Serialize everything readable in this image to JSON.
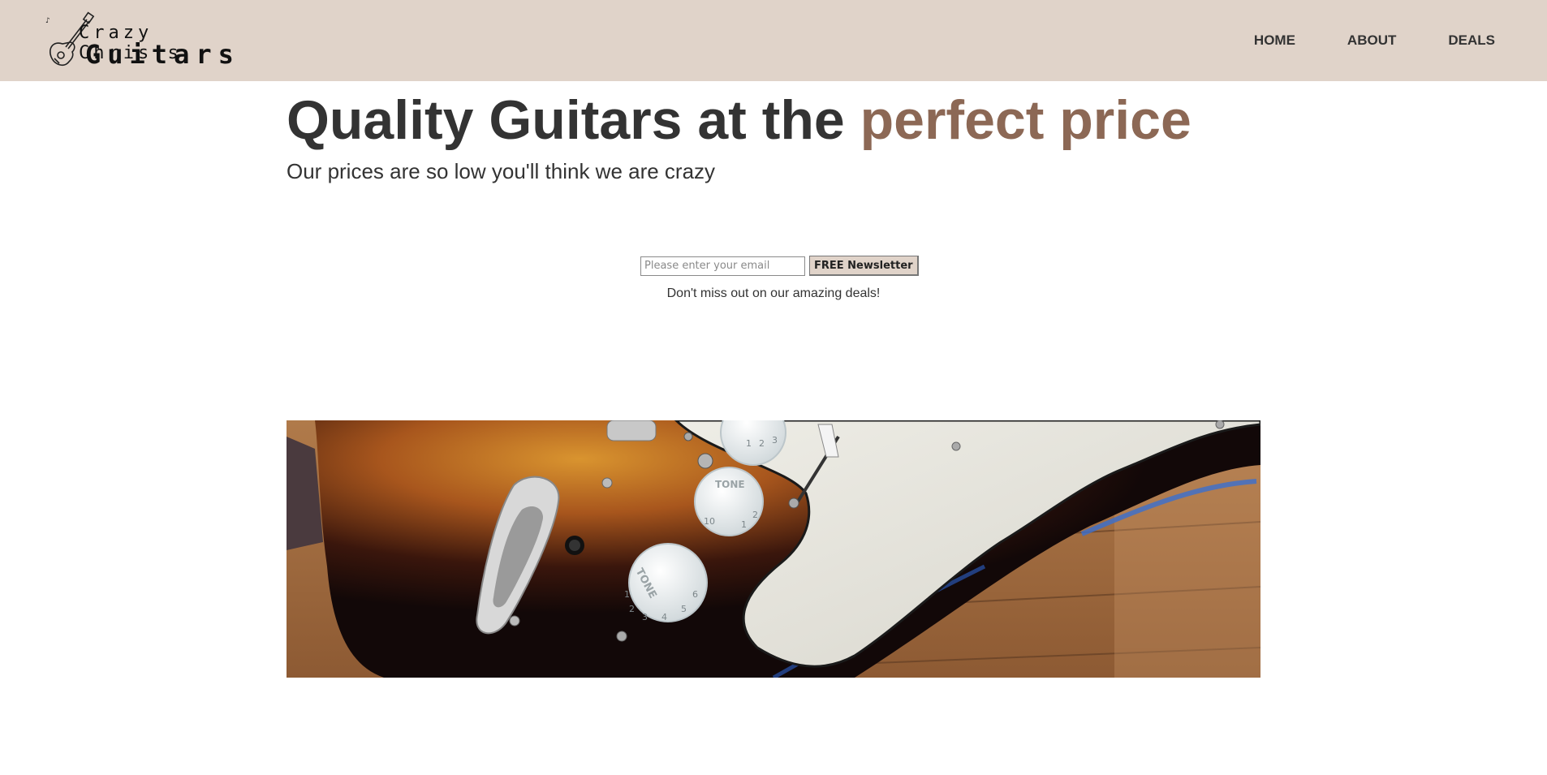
{
  "header": {
    "logo": {
      "line1": "Crazy Chris's",
      "line2": "Guitars"
    },
    "nav": [
      {
        "label": "HOME"
      },
      {
        "label": "ABOUT"
      },
      {
        "label": "DEALS"
      }
    ]
  },
  "hero": {
    "title_main": "Quality Guitars at the ",
    "title_accent": "perfect price",
    "subtitle": "Our prices are so low you'll think we are crazy"
  },
  "newsletter": {
    "email_placeholder": "Please enter your email",
    "button_label": "FREE Newsletter",
    "note": "Don't miss out on our amazing deals!"
  },
  "image": {
    "knob_label_1": "TONE",
    "knob_label_2": "TONE",
    "knob_numbers_top": [
      "1",
      "2",
      "3"
    ],
    "knob_numbers_mid": [
      "10",
      "1",
      "2"
    ],
    "knob_numbers_bottom": [
      "1",
      "2",
      "3",
      "4",
      "5",
      "6"
    ]
  },
  "colors": {
    "header_bg": "#e0d3c9",
    "accent": "#8c6855",
    "text": "#333333"
  }
}
